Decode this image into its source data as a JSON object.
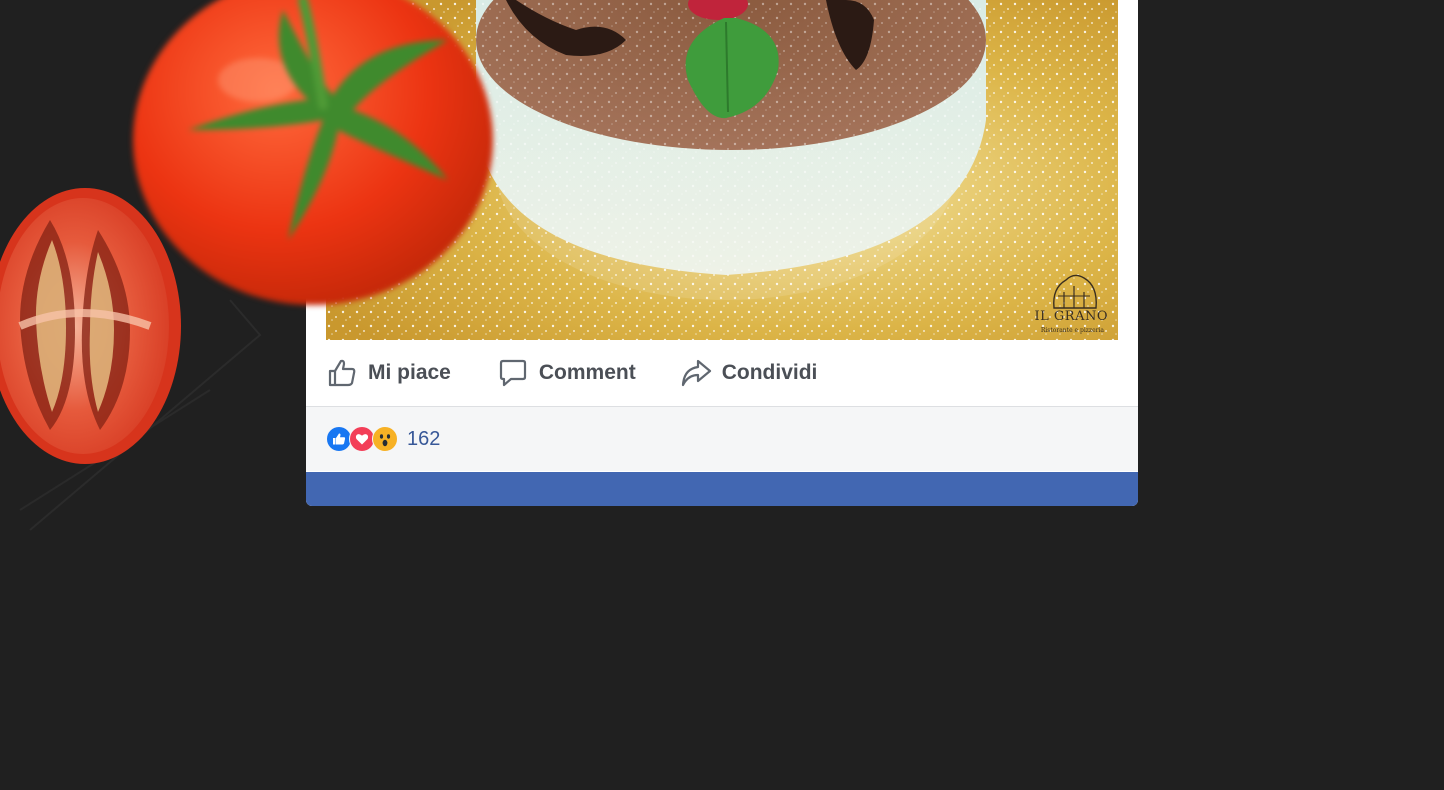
{
  "post": {
    "photo": {
      "logo_name": "IL GRANO",
      "logo_tagline": "Ristorante e pizzeria"
    },
    "actions": [
      {
        "label": "Mi piace",
        "icon": "thumbs-up-icon"
      },
      {
        "label": "Comment",
        "icon": "comment-icon"
      },
      {
        "label": "Condividi",
        "icon": "share-arrow-icon"
      }
    ],
    "reactions": {
      "icons": [
        "like-reaction-icon",
        "love-reaction-icon",
        "wow-reaction-icon"
      ],
      "count": "162"
    }
  },
  "colors": {
    "background": "#202020",
    "facebook_blue": "#4267b2",
    "count_blue": "#385898",
    "action_gray": "#606770",
    "like_blue": "#1877f2",
    "love_red": "#f33e58",
    "wow_yellow": "#f7b125"
  }
}
